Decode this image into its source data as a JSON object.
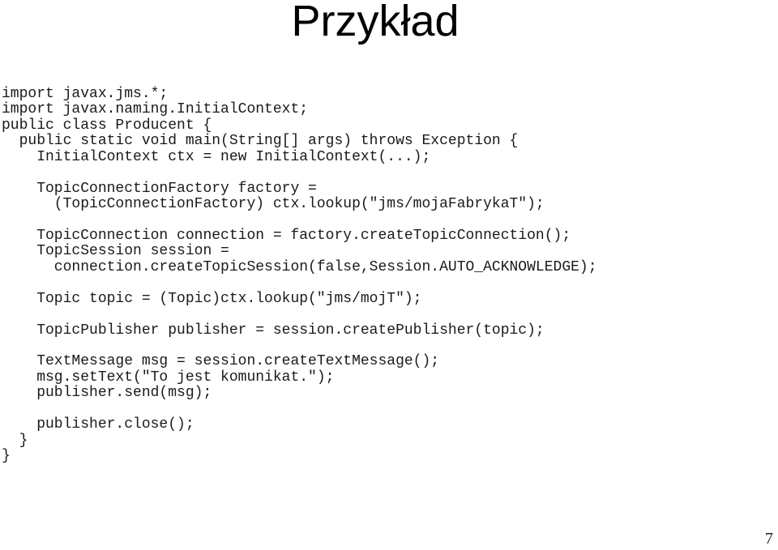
{
  "slide": {
    "title": "Przykład",
    "page_number": "7"
  },
  "code": {
    "language": "java",
    "lines": [
      "import javax.jms.*;",
      "import javax.naming.InitialContext;",
      "public class Producent {",
      "  public static void main(String[] args) throws Exception {",
      "    InitialContext ctx = new InitialContext(...);",
      "",
      "    TopicConnectionFactory factory =",
      "      (TopicConnectionFactory) ctx.lookup(\"jms/mojaFabrykaT\");",
      "",
      "    TopicConnection connection = factory.createTopicConnection();",
      "    TopicSession session =",
      "      connection.createTopicSession(false,Session.AUTO_ACKNOWLEDGE);",
      "",
      "    Topic topic = (Topic)ctx.lookup(\"jms/mojT\");",
      "",
      "    TopicPublisher publisher = session.createPublisher(topic);",
      "",
      "    TextMessage msg = session.createTextMessage();",
      "    msg.setText(\"To jest komunikat.\");",
      "    publisher.send(msg);",
      "",
      "    publisher.close();",
      "  }",
      "}"
    ]
  }
}
